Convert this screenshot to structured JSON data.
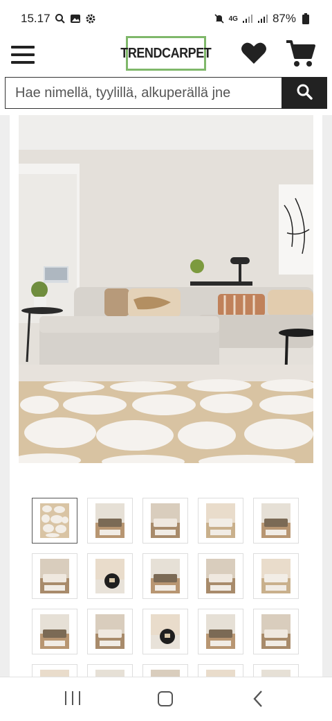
{
  "status_bar": {
    "time": "15.17",
    "network": "4G",
    "battery": "87%"
  },
  "header": {
    "logo_text": "TRENDCARPET",
    "menu_icon": "hamburger-icon",
    "wishlist_icon": "heart-icon",
    "cart_icon": "cart-icon"
  },
  "search": {
    "placeholder": "Hae nimellä, tyylillä, alkuperällä jne",
    "icon": "search-icon"
  },
  "gallery": {
    "main_image": "living room with beige sofa and white shaggy pebble-pattern rug",
    "thumbnails": [
      {
        "type": "rug",
        "active": true
      },
      {
        "type": "room"
      },
      {
        "type": "room"
      },
      {
        "type": "room"
      },
      {
        "type": "room"
      },
      {
        "type": "room"
      },
      {
        "type": "room-dark"
      },
      {
        "type": "room"
      },
      {
        "type": "room"
      },
      {
        "type": "room"
      },
      {
        "type": "room"
      },
      {
        "type": "room"
      },
      {
        "type": "room-dark"
      },
      {
        "type": "room"
      },
      {
        "type": "room"
      },
      {
        "type": "room"
      },
      {
        "type": "room"
      },
      {
        "type": "room"
      },
      {
        "type": "room"
      },
      {
        "type": "room"
      }
    ]
  },
  "colors": {
    "logo_border": "#7fb86a",
    "dark": "#222222"
  }
}
